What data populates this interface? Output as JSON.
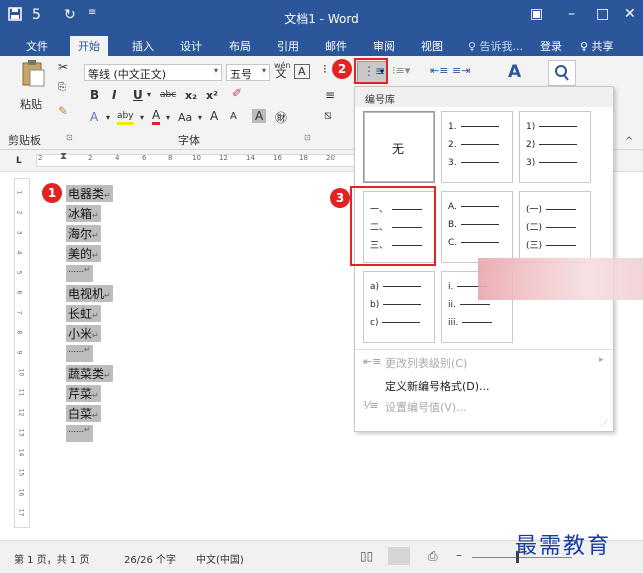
{
  "window": {
    "title": "文档1 - Word",
    "qa_save_icon": "save-icon",
    "qa_undo": "5",
    "qa_redo": "↻",
    "qa_more": "≡",
    "win_ribbon_opts": "▣",
    "win_min": "–",
    "win_max": "□",
    "win_close": "✕"
  },
  "tabs": [
    "文件",
    "开始",
    "插入",
    "设计",
    "布局",
    "引用",
    "邮件",
    "审阅",
    "视图"
  ],
  "tell_me": "♀ 告诉我...",
  "signin": "登录",
  "share": "♀ 共享",
  "ribbon": {
    "paste_label": "粘贴",
    "clipboard_group": "剪贴板",
    "font_group": "字体",
    "font_name": "等线 (中文正文)",
    "font_size": "五号",
    "wen_label": "wén\n文",
    "bold": "B",
    "italic": "I",
    "underline": "U",
    "strike": "abc",
    "subscript": "x₂",
    "superscript": "x²",
    "font_color": "A",
    "highlight": "aby",
    "change_case": "Aa",
    "grow": "A",
    "shrink": "A",
    "char_shading": "A",
    "enclose": "㊖",
    "font_expand": "⊡",
    "clipboard_expand": "⊡",
    "styles_icon": "A",
    "find_icon": "search-icon"
  },
  "ruler": {
    "ticks": [
      "2",
      "2",
      "4",
      "6",
      "8",
      "10",
      "12",
      "14",
      "16",
      "18",
      "20"
    ],
    "vticks": [
      "1",
      "2",
      "3",
      "4",
      "5",
      "6",
      "7",
      "8",
      "9",
      "10",
      "11",
      "12",
      "13",
      "14",
      "15",
      "16",
      "17"
    ]
  },
  "document": {
    "paragraphs": [
      "电器类",
      "冰箱",
      "海尔",
      "美的",
      "……",
      "电视机",
      "长虹",
      "小米",
      "……",
      "蔬菜类",
      "芹菜",
      "白菜",
      "……"
    ],
    "para_mark": "↵"
  },
  "badges": [
    "1",
    "2",
    "3"
  ],
  "numbering": {
    "header": "编号库",
    "none_label": "无",
    "formats": [
      [
        "1.",
        "2.",
        "3."
      ],
      [
        "1)",
        "2)",
        "3)"
      ],
      [
        "一、",
        "二、",
        "三、"
      ],
      [
        "A.",
        "B.",
        "C."
      ],
      [
        "(一)",
        "(二)",
        "(三)"
      ],
      [
        "a)",
        "b)",
        "c)"
      ],
      [
        "i.",
        "ii.",
        "iii."
      ]
    ],
    "menu": [
      {
        "label": "更改列表级别(C)",
        "enabled": false
      },
      {
        "label": "定义新编号格式(D)...",
        "enabled": true
      },
      {
        "label": "设置编号值(V)...",
        "enabled": false
      }
    ]
  },
  "status": {
    "page": "第 1 页，共 1 页",
    "words": "26/26 个字",
    "lang": "中文(中国)"
  },
  "watermark": "最需教育",
  "colors": {
    "accent": "#2b579a",
    "highlight": "#e02424"
  }
}
